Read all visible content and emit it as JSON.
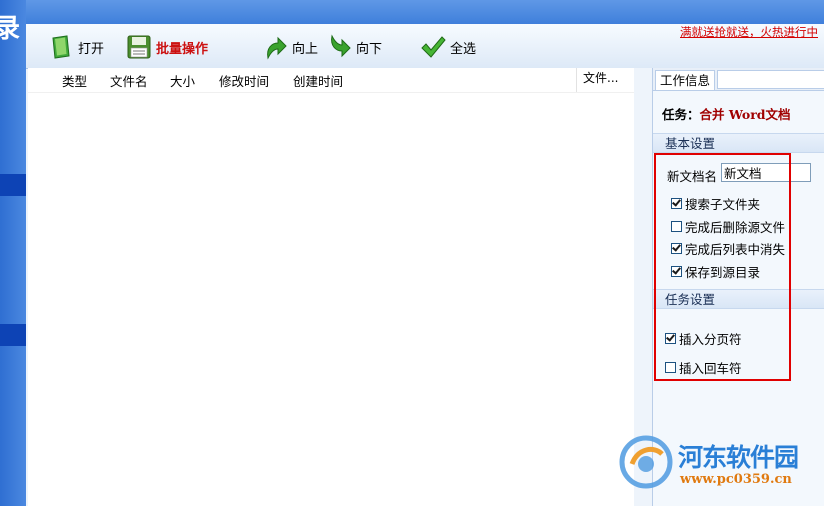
{
  "toolbar": {
    "open_label": "打开",
    "batch_label": "批量操作",
    "up_label": "向上",
    "down_label": "向下",
    "select_all_label": "全选"
  },
  "promo_text": "满就送抢就送，火热进行中",
  "file_list": {
    "columns": [
      "类型",
      "文件名",
      "大小",
      "修改时间",
      "创建时间",
      "文件..."
    ],
    "rows": []
  },
  "panel": {
    "tab_label": "工作信息",
    "task_prefix": "任务：",
    "task_name": "合并 Word文档",
    "basic_section": "基本设置",
    "new_doc_label": "新文档名",
    "new_doc_value": "新文档",
    "options_basic": [
      {
        "label": "搜索子文件夹",
        "checked": true
      },
      {
        "label": "完成后删除源文件",
        "checked": false
      },
      {
        "label": "完成后列表中消失",
        "checked": true
      },
      {
        "label": "保存到源目录",
        "checked": true
      }
    ],
    "task_section": "任务设置",
    "options_task": [
      {
        "label": "插入分页符",
        "checked": true
      },
      {
        "label": "插入回车符",
        "checked": false
      }
    ]
  },
  "left_glyph": "录",
  "watermark": {
    "title": "河东软件园",
    "url": "www.pc0359.cn"
  },
  "colors": {
    "accent_red": "#e00000",
    "task_name": "#a00000",
    "sidebar_blue": "#0d43b5"
  }
}
